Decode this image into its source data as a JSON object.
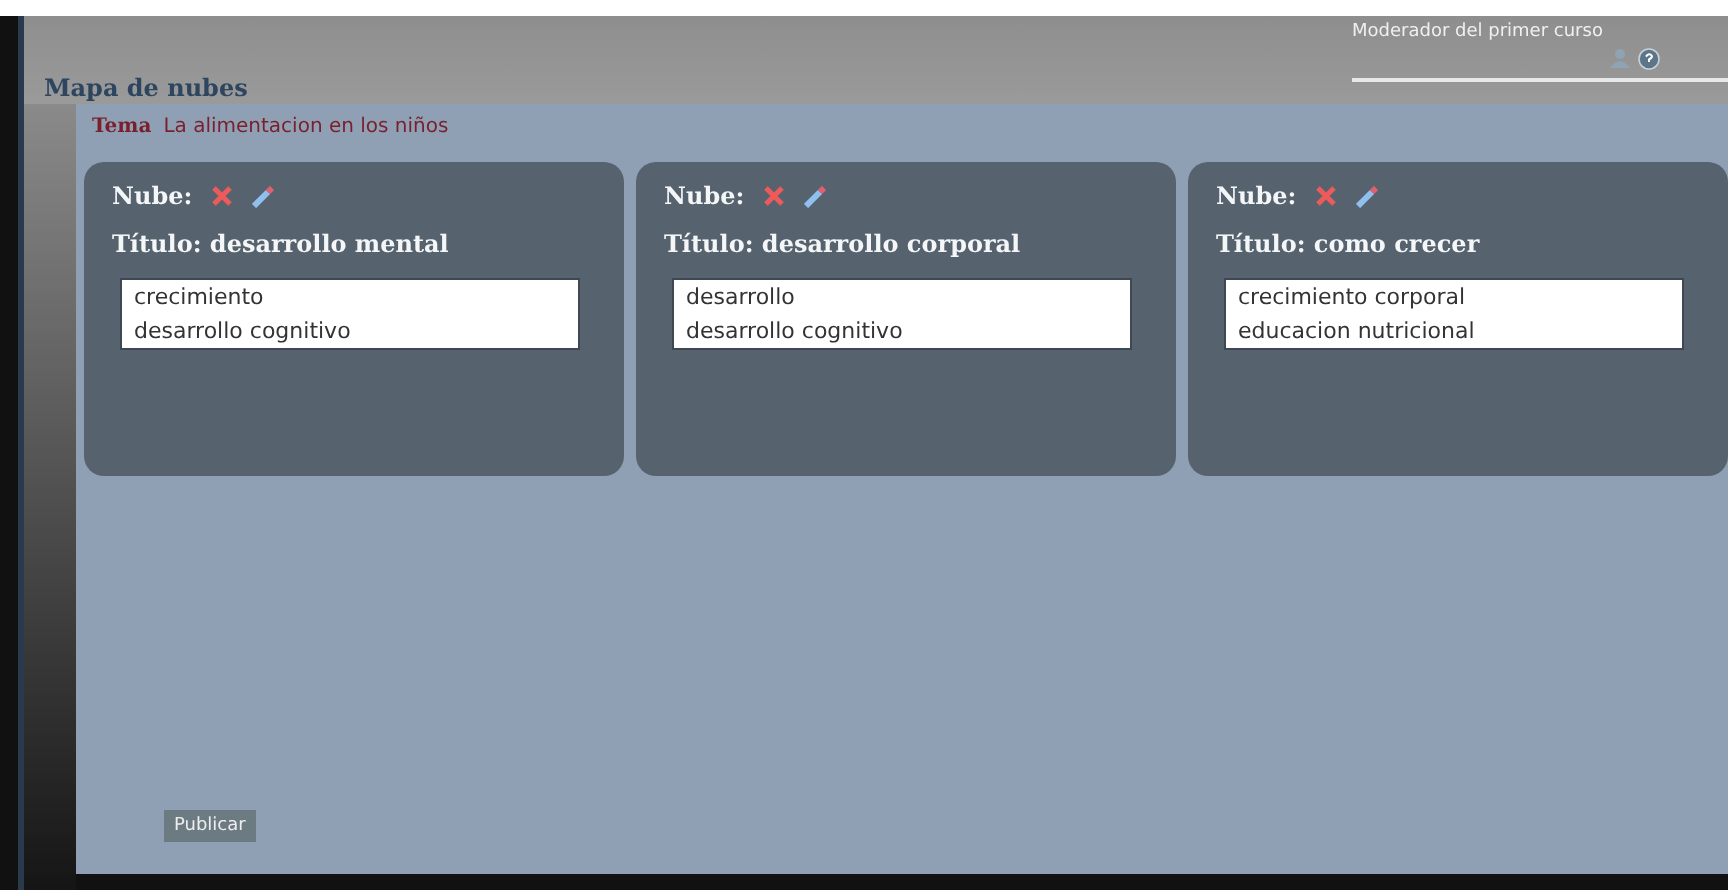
{
  "header": {
    "title": "Mapa de nubes",
    "user": "Moderador del primer curso"
  },
  "topic": {
    "label": "Tema",
    "value": "La alimentacion en los niños"
  },
  "clouds": [
    {
      "label": "Nube:",
      "title": "Título: desarrollo mental",
      "words": [
        "crecimiento",
        "desarrollo cognitivo"
      ]
    },
    {
      "label": "Nube:",
      "title": "Título: desarrollo corporal",
      "words": [
        "desarrollo",
        "desarrollo cognitivo"
      ]
    },
    {
      "label": "Nube:",
      "title": "Título: como crecer",
      "words": [
        "crecimiento corporal",
        "educacion nutricional"
      ]
    }
  ],
  "publish_button": "Publicar"
}
